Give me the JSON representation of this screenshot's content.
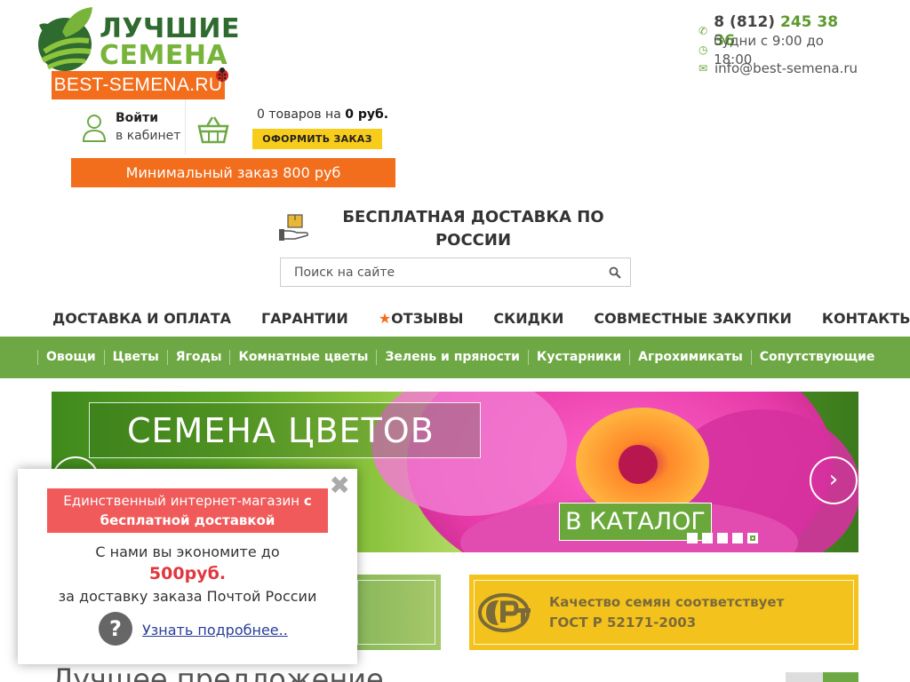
{
  "logo": {
    "line1": "ЛУЧШИЕ",
    "line2": "СЕМЕНА",
    "site": "BEST-SEMENA.RU"
  },
  "contacts": {
    "phone_prefix": "8 (812)",
    "phone_number": "245 38 36",
    "hours": "будни с 9:00 до 18:00",
    "email": "info@best-semena.ru"
  },
  "account": {
    "login": "Войти",
    "cabinet": "в кабинет"
  },
  "cart": {
    "count_text": "0 товаров на",
    "sum": "0 руб.",
    "order_button": "ОФОРМИТЬ ЗАКАЗ"
  },
  "min_order": "Минимальный заказ 800 руб",
  "delivery": "БЕСПЛАТНАЯ ДОСТАВКА ПО РОССИИ",
  "search": {
    "placeholder": "Поиск на сайте"
  },
  "main_nav": [
    "ДОСТАВКА И ОПЛАТА",
    "ГАРАНТИИ",
    "ОТЗЫВЫ",
    "СКИДКИ",
    "СОВМЕСТНЫЕ ЗАКУПКИ",
    "КОНТАКТЫ"
  ],
  "category_nav": [
    "Овощи",
    "Цветы",
    "Ягоды",
    "Комнатные цветы",
    "Зелень и пряности",
    "Кустарники",
    "Агрохимикаты",
    "Сопутствующие"
  ],
  "banner": {
    "title": "СЕМЕНА ЦВЕТОВ",
    "button": "В КАТАЛОГ",
    "slides_total": 5,
    "active_slide": 5
  },
  "quality": {
    "line1": "Качество семян соответствует",
    "line2": "ГОСТ Р 52171-2003"
  },
  "best_offer_title": "Лучшее предложение",
  "popup": {
    "badge_part1": "Единственный интернет-магазин",
    "badge_part2": "с бесплатной доставкой",
    "line1": "С нами вы экономите до",
    "sum": "500руб.",
    "line2": "за доставку заказа Почтой России",
    "link": "Узнать подробнее.."
  },
  "colors": {
    "brand_green": "#6ea844",
    "brand_orange": "#f26d1c",
    "order_yellow": "#f8cc1b",
    "popup_red": "#f05a5a"
  }
}
